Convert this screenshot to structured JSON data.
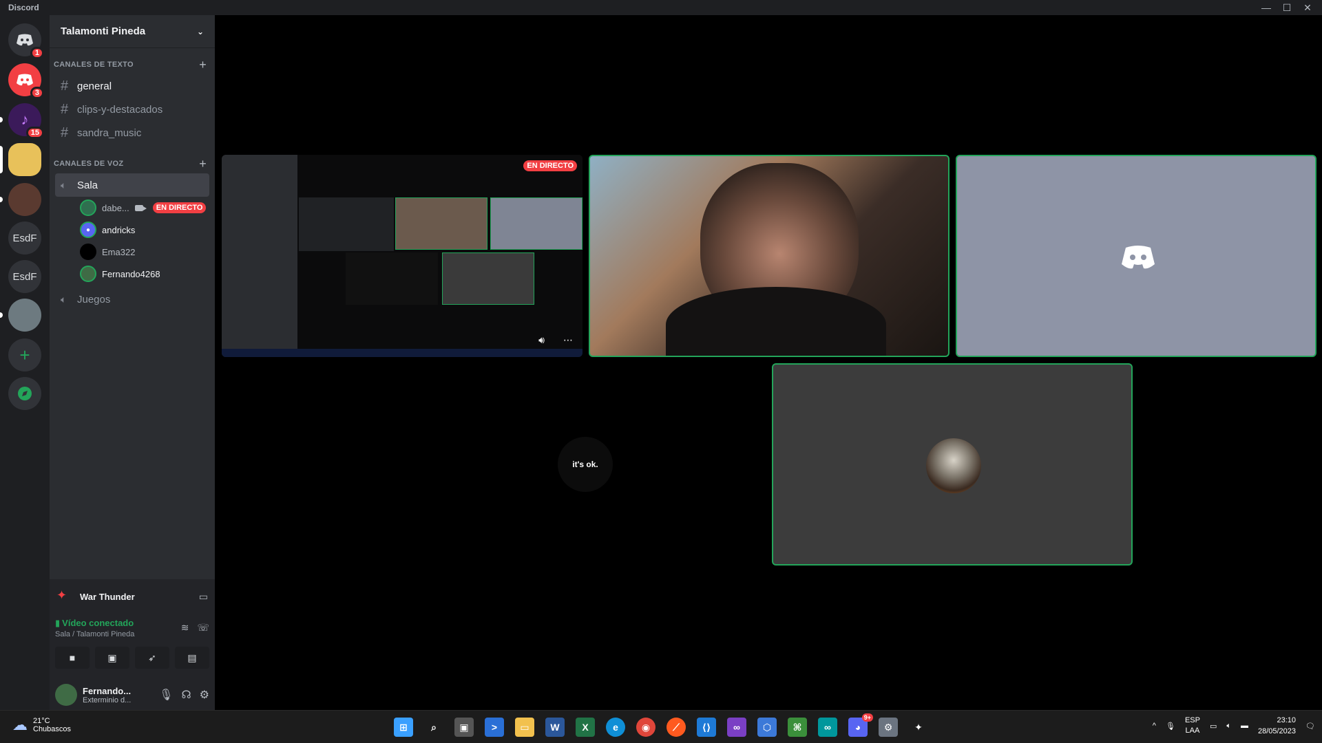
{
  "app": {
    "title": "Discord"
  },
  "window_controls": {
    "minimize": "—",
    "maximize": "☐",
    "close": "✕"
  },
  "guilds": [
    {
      "name": "home",
      "label": "",
      "badge": "1"
    },
    {
      "name": "server-red",
      "label": "",
      "badge": "3"
    },
    {
      "name": "server-music",
      "label": "",
      "badge": "15"
    },
    {
      "name": "server-avatar",
      "label": ""
    },
    {
      "name": "server-photo",
      "label": ""
    },
    {
      "name": "server-esdf-1",
      "label": "EsdF"
    },
    {
      "name": "server-esdf-2",
      "label": "EsdF"
    },
    {
      "name": "server-deer",
      "label": ""
    },
    {
      "name": "add-server",
      "label": "+"
    },
    {
      "name": "explore",
      "label": ""
    }
  ],
  "server": {
    "name": "Talamonti Pineda"
  },
  "text_category": {
    "label": "CANALES DE TEXTO"
  },
  "text_channels": [
    {
      "label": "general"
    },
    {
      "label": "clips-y-destacados"
    },
    {
      "label": "sandra_music"
    }
  ],
  "voice_category": {
    "label": "CANALES DE VOZ"
  },
  "voice_channels": [
    {
      "label": "Sala"
    },
    {
      "label": "Juegos"
    }
  ],
  "voice_users": [
    {
      "name": "dabe...",
      "live": "EN DIRECTO",
      "color": "#2f6f4f"
    },
    {
      "name": "andricks",
      "color": "#5865f2"
    },
    {
      "name": "Ema322",
      "color": "#000000"
    },
    {
      "name": "Fernando4268",
      "color": "#3f6b45"
    }
  ],
  "activity": {
    "game": "War Thunder"
  },
  "rtc": {
    "status": "Vídeo conectado",
    "location": "Sala / Talamonti Pineda"
  },
  "user": {
    "name": "Fernando...",
    "status": "Exterminio d..."
  },
  "stream_tile": {
    "live_label": "EN DIRECTO"
  },
  "ok_tile": {
    "avatar_text": "it's ok."
  },
  "taskbar": {
    "weather_temp": "21°C",
    "weather_desc": "Chubascos",
    "lang": "ESP",
    "layout": "LAA",
    "time": "23:10",
    "date": "28/05/2023",
    "discord_badge": "9+"
  },
  "colors": {
    "speaking": "#23a55a",
    "live": "#f23f43",
    "blurple": "#5865f2"
  }
}
